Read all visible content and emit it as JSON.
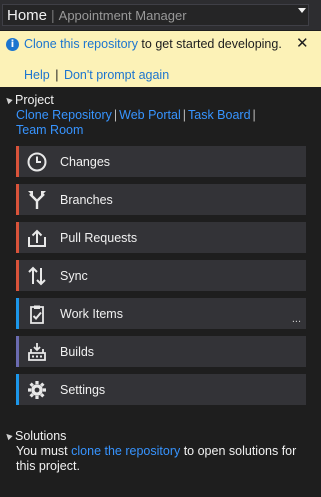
{
  "header": {
    "title": "Home",
    "subtitle": "Appointment Manager",
    "dropdown_icon": "chevron-down-icon"
  },
  "infobar": {
    "icon": "info-icon",
    "link_text": "Clone this repository",
    "message": " to get started developing.",
    "help_label": "Help",
    "separator": "|",
    "dismiss_label": "Don't prompt again",
    "close_glyph": "✕",
    "background": "#fcf2b7"
  },
  "project": {
    "heading": "Project",
    "links": [
      "Clone Repository",
      "Web Portal",
      "Task Board",
      "Team Room"
    ],
    "separator": "|"
  },
  "nav": [
    {
      "label": "Changes",
      "icon": "clock-icon",
      "accent": "#d9533a"
    },
    {
      "label": "Branches",
      "icon": "branch-icon",
      "accent": "#d9533a"
    },
    {
      "label": "Pull Requests",
      "icon": "pull-request-icon",
      "accent": "#d9533a"
    },
    {
      "label": "Sync",
      "icon": "sync-arrows-icon",
      "accent": "#d9533a"
    },
    {
      "label": "Work Items",
      "icon": "clipboard-check-icon",
      "accent": "#1c97ea",
      "more": "..."
    },
    {
      "label": "Builds",
      "icon": "build-icon",
      "accent": "#6b6bb0"
    },
    {
      "label": "Settings",
      "icon": "gear-icon",
      "accent": "#1c97ea"
    }
  ],
  "solutions": {
    "heading": "Solutions",
    "text_before": "You must ",
    "link_text": "clone the repository",
    "text_after": " to open solutions for this project."
  }
}
